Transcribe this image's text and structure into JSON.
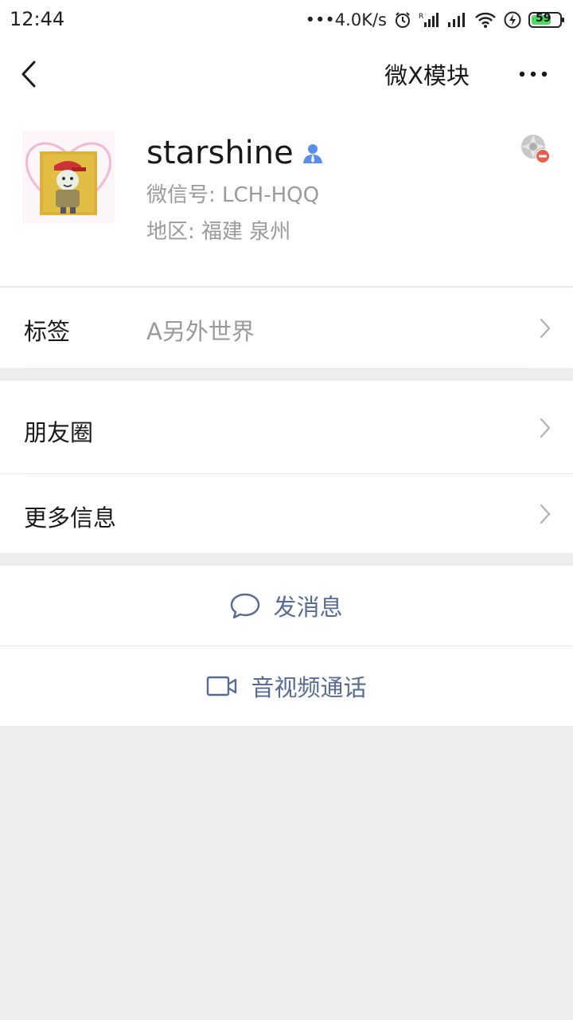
{
  "status_bar": {
    "time": "12:44",
    "network_speed": "•••4.0K/s",
    "battery": "59",
    "icons": [
      "alarm-icon",
      "signal-icon",
      "signal-icon",
      "wifi-icon",
      "charging-icon",
      "battery-icon"
    ]
  },
  "nav": {
    "title": "微X模块",
    "back_icon": "chevron-left-icon",
    "more_icon": "more-dots-icon"
  },
  "profile": {
    "nickname": "starshine",
    "wechat_id": "微信号: LCH-HQQ",
    "region": "地区: 福建  泉州",
    "badge_icon": "contact-person-icon",
    "status_icon": "moments-blocked-icon"
  },
  "tag_row": {
    "label": "标签",
    "value": "A另外世界"
  },
  "moments_row": {
    "label": "朋友圈"
  },
  "more_info_row": {
    "label": "更多信息"
  },
  "actions": {
    "send_message": "发消息",
    "video_call": "音视频通话"
  },
  "colors": {
    "link": "#576b95",
    "secondary_text": "#9a9a9a",
    "background": "#ededed",
    "battery_green": "#4cd964"
  }
}
